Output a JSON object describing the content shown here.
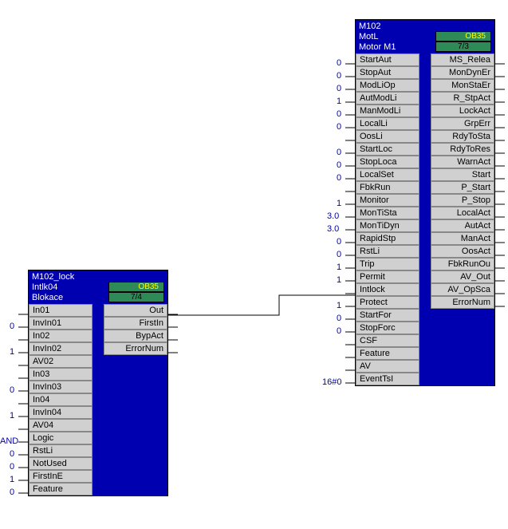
{
  "block1": {
    "header": {
      "line1": "M102_lock",
      "line2": "Intlk04",
      "line3": "Blokace",
      "ob": "OB35",
      "id": "7/4"
    },
    "inputs": [
      {
        "label": "In01",
        "val": ""
      },
      {
        "label": "InvIn01",
        "val": "0"
      },
      {
        "label": "In02",
        "val": ""
      },
      {
        "label": "InvIn02",
        "val": "1"
      },
      {
        "label": "AV02",
        "val": ""
      },
      {
        "label": "In03",
        "val": ""
      },
      {
        "label": "InvIn03",
        "val": "0"
      },
      {
        "label": "In04",
        "val": ""
      },
      {
        "label": "InvIn04",
        "val": "1"
      },
      {
        "label": "AV04",
        "val": ""
      },
      {
        "label": "Logic",
        "val": "AND"
      },
      {
        "label": "RstLi",
        "val": "0"
      },
      {
        "label": "NotUsed",
        "val": "0"
      },
      {
        "label": "FirstInE",
        "val": "1"
      },
      {
        "label": "Feature",
        "val": "0"
      }
    ],
    "outputs": [
      {
        "label": "Out"
      },
      {
        "label": "FirstIn"
      },
      {
        "label": "BypAct"
      },
      {
        "label": "ErrorNum"
      }
    ]
  },
  "block2": {
    "header": {
      "line1": "M102",
      "line2": "MotL",
      "line3": "Motor M1",
      "ob": "OB35",
      "id": "7/3"
    },
    "inputs": [
      {
        "label": "StartAut",
        "val": "0"
      },
      {
        "label": "StopAut",
        "val": "0"
      },
      {
        "label": "ModLiOp",
        "val": "0"
      },
      {
        "label": "AutModLi",
        "val": "1"
      },
      {
        "label": "ManModLi",
        "val": "0"
      },
      {
        "label": "LocalLi",
        "val": "0"
      },
      {
        "label": "OosLi",
        "val": ""
      },
      {
        "label": "StartLoc",
        "val": "0"
      },
      {
        "label": "StopLoca",
        "val": "0"
      },
      {
        "label": "LocalSet",
        "val": "0"
      },
      {
        "label": "FbkRun",
        "val": ""
      },
      {
        "label": "Monitor",
        "val": "1"
      },
      {
        "label": "MonTiSta",
        "val": "3.0"
      },
      {
        "label": "MonTiDyn",
        "val": "3.0"
      },
      {
        "label": "RapidStp",
        "val": "0"
      },
      {
        "label": "RstLi",
        "val": "0"
      },
      {
        "label": "Trip",
        "val": "1"
      },
      {
        "label": "Permit",
        "val": "1"
      },
      {
        "label": "Intlock",
        "val": ""
      },
      {
        "label": "Protect",
        "val": "1"
      },
      {
        "label": "StartFor",
        "val": "0"
      },
      {
        "label": "StopForc",
        "val": "0"
      },
      {
        "label": "CSF",
        "val": ""
      },
      {
        "label": "Feature",
        "val": ""
      },
      {
        "label": "AV",
        "val": ""
      },
      {
        "label": "EventTsI",
        "val": "16#0"
      }
    ],
    "outputs": [
      {
        "label": "MS_Relea"
      },
      {
        "label": "MonDynEr"
      },
      {
        "label": "MonStaEr"
      },
      {
        "label": "R_StpAct"
      },
      {
        "label": "LockAct"
      },
      {
        "label": "GrpErr"
      },
      {
        "label": "RdyToSta"
      },
      {
        "label": "RdyToRes"
      },
      {
        "label": "WarnAct"
      },
      {
        "label": "Start"
      },
      {
        "label": "P_Start"
      },
      {
        "label": "P_Stop"
      },
      {
        "label": "LocalAct"
      },
      {
        "label": "AutAct"
      },
      {
        "label": "ManAct"
      },
      {
        "label": "OosAct"
      },
      {
        "label": "FbkRunOu"
      },
      {
        "label": "AV_Out"
      },
      {
        "label": "AV_OpSca"
      },
      {
        "label": "ErrorNum"
      }
    ]
  },
  "wires": {
    "out_to_intlock": {
      "from": "block1.Out",
      "to": "block2.Intlock"
    }
  }
}
